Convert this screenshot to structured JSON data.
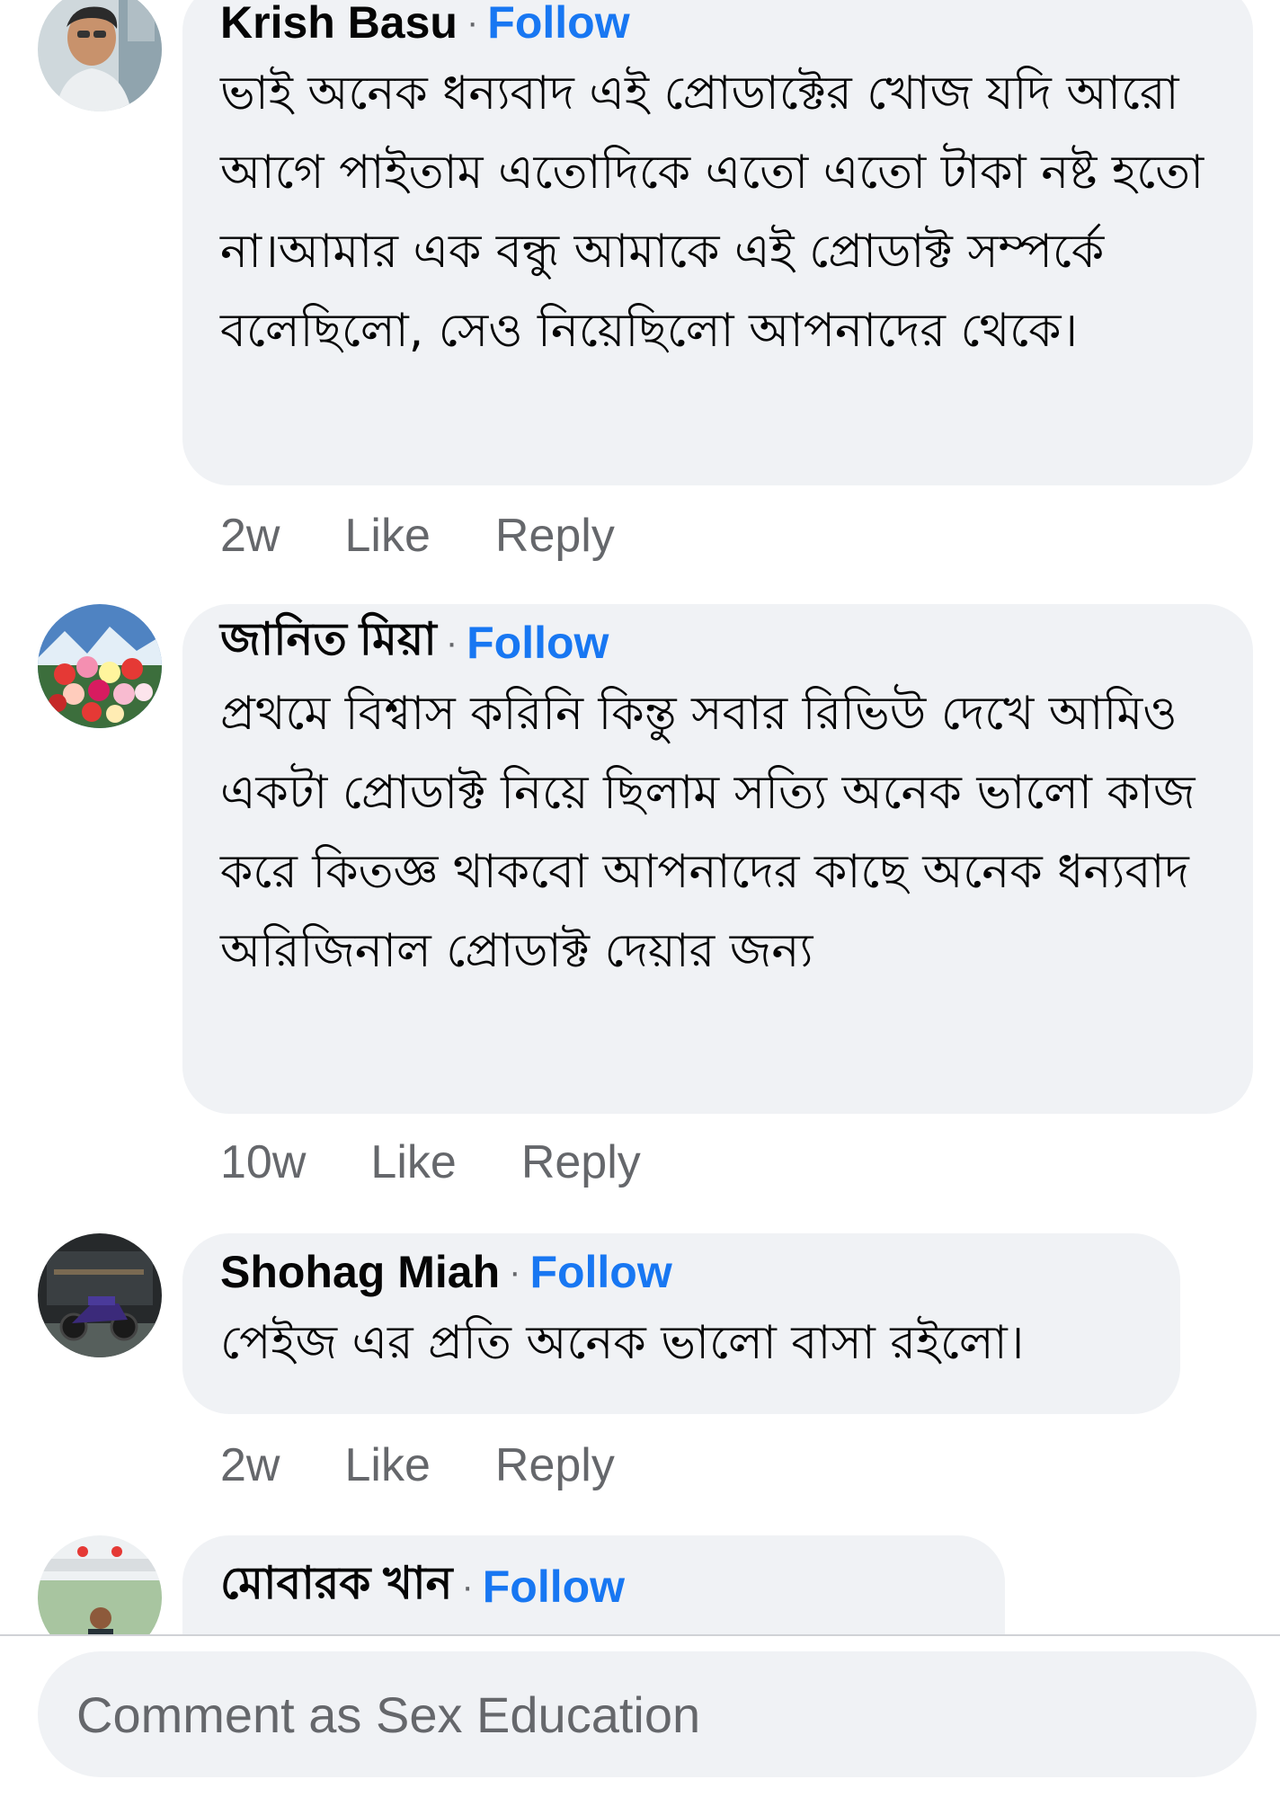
{
  "comments": [
    {
      "author": "Krish Basu",
      "follow_label": "Follow",
      "text": "ভাই অনেক ধন্যবাদ এই প্রোডাক্টের খোজ যদি আরো আগে পাইতাম এতোদিকে এতো এতো টাকা নষ্ট হতো না।আমার এক বন্ধু আমাকে এই প্রোডাক্ট সম্পর্কে বলেছিলো, সেও নিয়েছিলো আপনাদের থেকে।",
      "time": "2w",
      "like_label": "Like",
      "reply_label": "Reply"
    },
    {
      "author": "জানিত মিয়া",
      "follow_label": "Follow",
      "text": "প্রথমে বিশ্বাস করিনি কিন্তু সবার রিভিউ দেখে আমিও একটা প্রোডাক্ট নিয়ে ছিলাম সত্যি অনেক ভালো কাজ করে কিতজ্ঞ থাকবো আপনাদের কাছে অনেক ধন্যবাদ অরিজিনাল প্রোডাক্ট দেয়ার জন্য",
      "time": "10w",
      "like_label": "Like",
      "reply_label": "Reply"
    },
    {
      "author": "Shohag Miah",
      "follow_label": "Follow",
      "text": "পেইজ এর প্রতি অনেক ভালো বাসা রইলো।",
      "time": "2w",
      "like_label": "Like",
      "reply_label": "Reply"
    },
    {
      "author": "মোবারক খান",
      "follow_label": "Follow"
    }
  ],
  "composer": {
    "placeholder": "Comment as Sex Education"
  },
  "colors": {
    "link_blue": "#1877f2",
    "bubble_gray": "#f0f2f5",
    "secondary_text": "#65676b"
  }
}
